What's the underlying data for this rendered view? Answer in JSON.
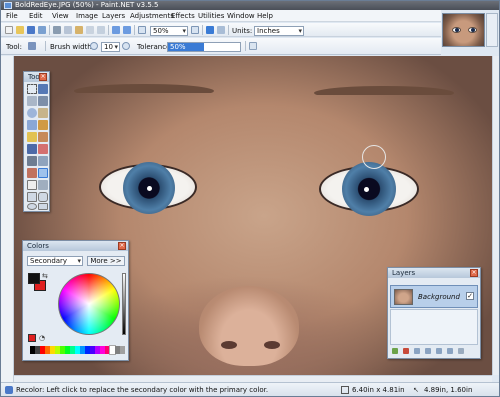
{
  "window": {
    "title": "BoldRedEye.JPG (50%) - Paint.NET v3.5.5"
  },
  "menu": [
    "File",
    "Edit",
    "View",
    "Image",
    "Layers",
    "Adjustments",
    "Effects",
    "Utilities",
    "Window",
    "Help"
  ],
  "toolbar1": {
    "zoom_value": "50%",
    "units_label": "Units:",
    "units_value": "Inches"
  },
  "toolbar2": {
    "tool_label": "Tool:",
    "brush_width_label": "Brush width:",
    "brush_width_value": "10",
    "tolerance_label": "Tolerance:",
    "tolerance_value": "50%",
    "tolerance_fraction": 0.5
  },
  "tools_window": {
    "title": "Tools"
  },
  "colors_window": {
    "title": "Colors",
    "mode_value": "Secondary",
    "more_label": "More >>",
    "primary_color": "#111111",
    "secondary_color": "#e02020"
  },
  "layers_window": {
    "title": "Layers",
    "layer_name": "Background",
    "layer_visible": true
  },
  "status": {
    "hint": "Recolor: Left click to replace the secondary color with the primary color.",
    "image_size": "6.40in x 4.81in",
    "cursor_position": "4.89in, 1.60in"
  },
  "colors": {
    "accent": "#3a7bd5",
    "title_bar": "#4a4f58"
  }
}
